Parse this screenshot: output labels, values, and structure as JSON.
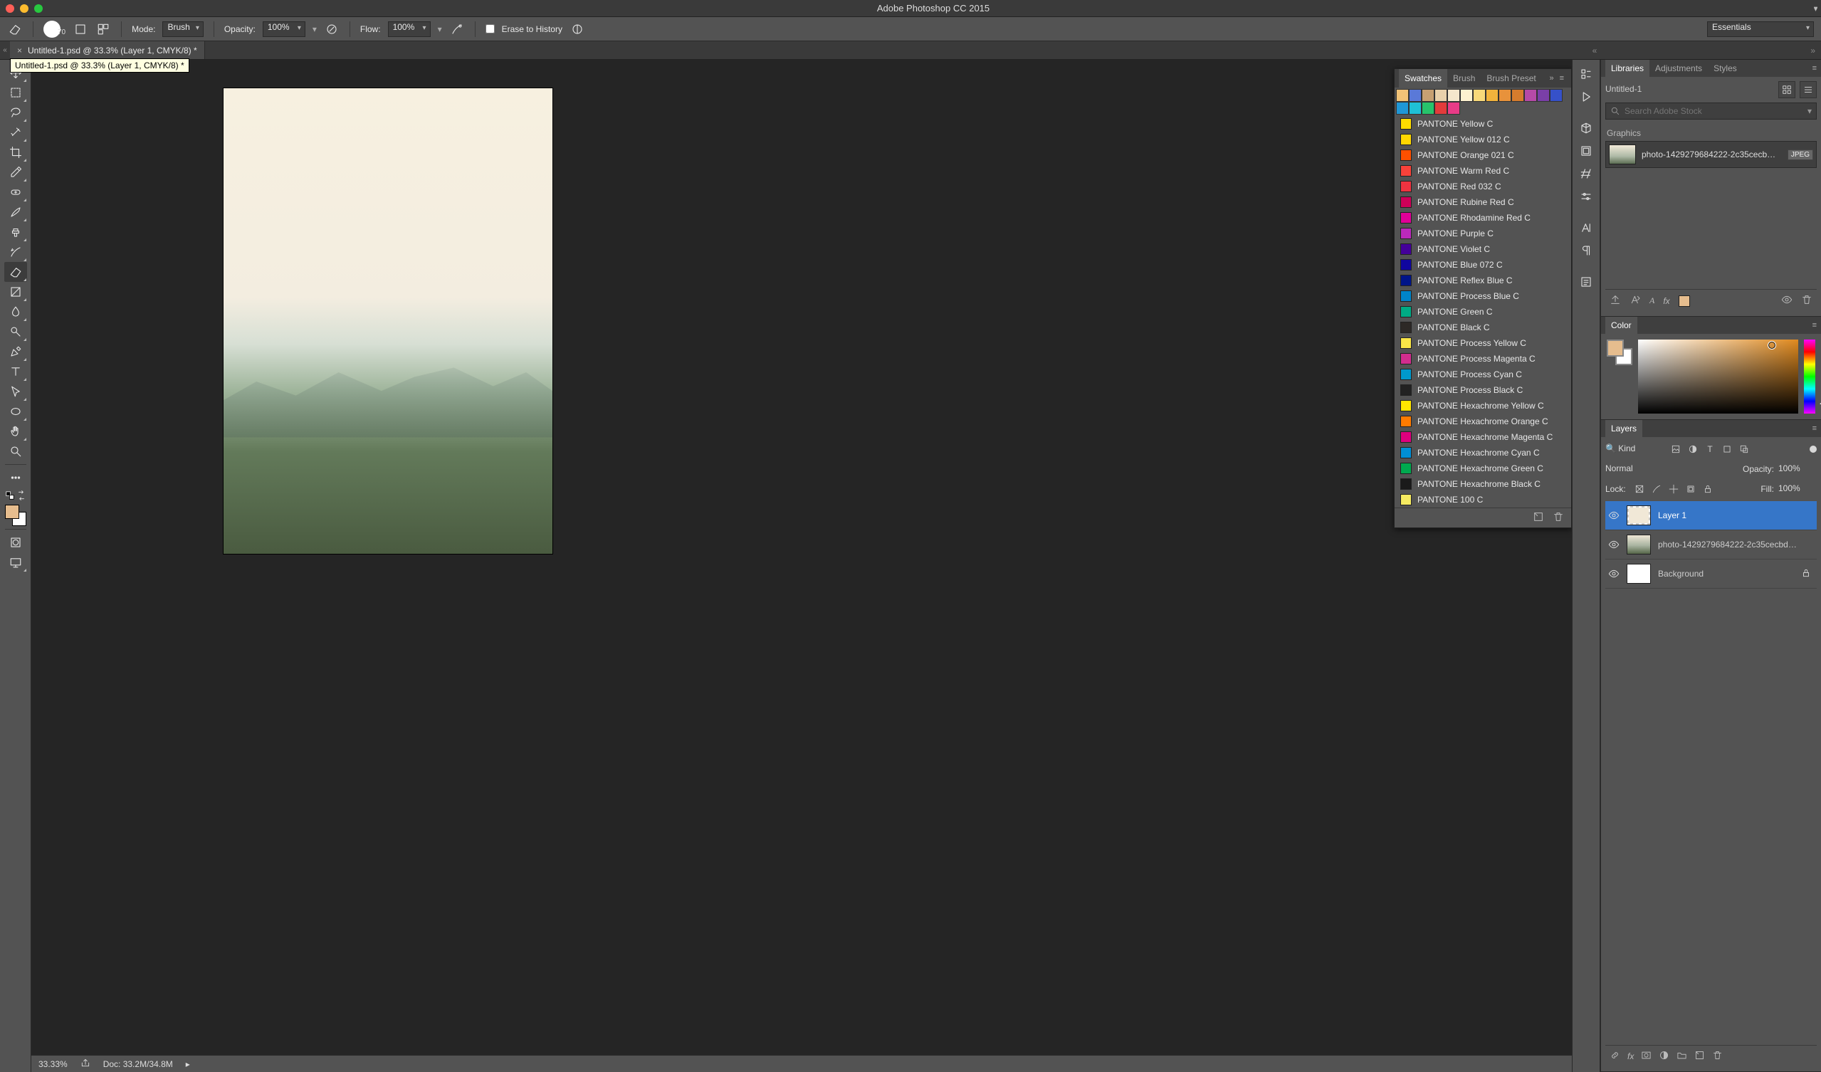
{
  "app": {
    "title": "Adobe Photoshop CC 2015"
  },
  "workspace": {
    "selected": "Essentials"
  },
  "optbar": {
    "brush_size": "70",
    "mode_label": "Mode:",
    "mode_value": "Brush",
    "opacity_label": "Opacity:",
    "opacity_value": "100%",
    "flow_label": "Flow:",
    "flow_value": "100%",
    "erase_hist_label": "Erase to History"
  },
  "document": {
    "tab_title": "Untitled-1.psd @ 33.3% (Layer 1, CMYK/8) *",
    "tooltip": "Untitled-1.psd @ 33.3% (Layer 1, CMYK/8) *"
  },
  "status": {
    "zoom": "33.33%",
    "doc_info": "Doc: 33.2M/34.8M"
  },
  "swatches_panel": {
    "tabs": [
      "Swatches",
      "Brush",
      "Brush Preset"
    ],
    "grid_colors": [
      "#f1c277",
      "#5a79d8",
      "#c7a072",
      "#e9d1ab",
      "#f5e7cc",
      "#fdf2d0",
      "#f8d97a",
      "#f2b33c",
      "#e8923b",
      "#d67c2d",
      "#b64aa7",
      "#7a3fa7",
      "#3651c9",
      "#1f97d6",
      "#1fc0d6",
      "#27c36b",
      "#e33b3b",
      "#e83b87"
    ],
    "list": [
      {
        "name": "PANTONE Yellow C",
        "hex": "#fedd00"
      },
      {
        "name": "PANTONE Yellow 012 C",
        "hex": "#ffd700"
      },
      {
        "name": "PANTONE Orange 021 C",
        "hex": "#fe5000"
      },
      {
        "name": "PANTONE Warm Red C",
        "hex": "#f9423a"
      },
      {
        "name": "PANTONE Red 032 C",
        "hex": "#ef3340"
      },
      {
        "name": "PANTONE Rubine Red C",
        "hex": "#ce0058"
      },
      {
        "name": "PANTONE Rhodamine Red C",
        "hex": "#e10098"
      },
      {
        "name": "PANTONE Purple C",
        "hex": "#bb29bb"
      },
      {
        "name": "PANTONE Violet C",
        "hex": "#440099"
      },
      {
        "name": "PANTONE Blue 072 C",
        "hex": "#10069f"
      },
      {
        "name": "PANTONE Reflex Blue C",
        "hex": "#001489"
      },
      {
        "name": "PANTONE Process Blue C",
        "hex": "#0085ca"
      },
      {
        "name": "PANTONE Green C",
        "hex": "#00ab84"
      },
      {
        "name": "PANTONE Black C",
        "hex": "#2d2926"
      },
      {
        "name": "PANTONE Process Yellow C",
        "hex": "#f9e547"
      },
      {
        "name": "PANTONE Process Magenta C",
        "hex": "#d12d8e"
      },
      {
        "name": "PANTONE Process Cyan C",
        "hex": "#0099cc"
      },
      {
        "name": "PANTONE Process Black C",
        "hex": "#222222"
      },
      {
        "name": "PANTONE Hexachrome Yellow C",
        "hex": "#ffe600"
      },
      {
        "name": "PANTONE Hexachrome Orange C",
        "hex": "#ff7b00"
      },
      {
        "name": "PANTONE Hexachrome Magenta C",
        "hex": "#de007e"
      },
      {
        "name": "PANTONE Hexachrome Cyan C",
        "hex": "#008fd5"
      },
      {
        "name": "PANTONE Hexachrome Green C",
        "hex": "#00a94f"
      },
      {
        "name": "PANTONE Hexachrome Black C",
        "hex": "#1a1a1a"
      },
      {
        "name": "PANTONE 100 C",
        "hex": "#f6eb61"
      }
    ]
  },
  "libraries": {
    "tabs": [
      "Libraries",
      "Adjustments",
      "Styles"
    ],
    "dropdown": "Untitled-1",
    "search_placeholder": "Search Adobe Stock",
    "section": "Graphics",
    "asset_name": "photo-1429279684222-2c35cecb…",
    "asset_badge": "JPEG"
  },
  "color_panel": {
    "tab": "Color"
  },
  "layers_panel": {
    "tab": "Layers",
    "filter": "Kind",
    "blend_mode": "Normal",
    "opacity_label": "Opacity:",
    "opacity_value": "100%",
    "lock_label": "Lock:",
    "fill_label": "Fill:",
    "fill_value": "100%",
    "layers": [
      {
        "name": "Layer 1",
        "selected": true,
        "thumb": "overlay"
      },
      {
        "name": "photo-1429279684222-2c35cecbd…",
        "selected": false,
        "thumb": "photo"
      },
      {
        "name": "Background",
        "selected": false,
        "thumb": "white",
        "locked": true
      }
    ]
  }
}
